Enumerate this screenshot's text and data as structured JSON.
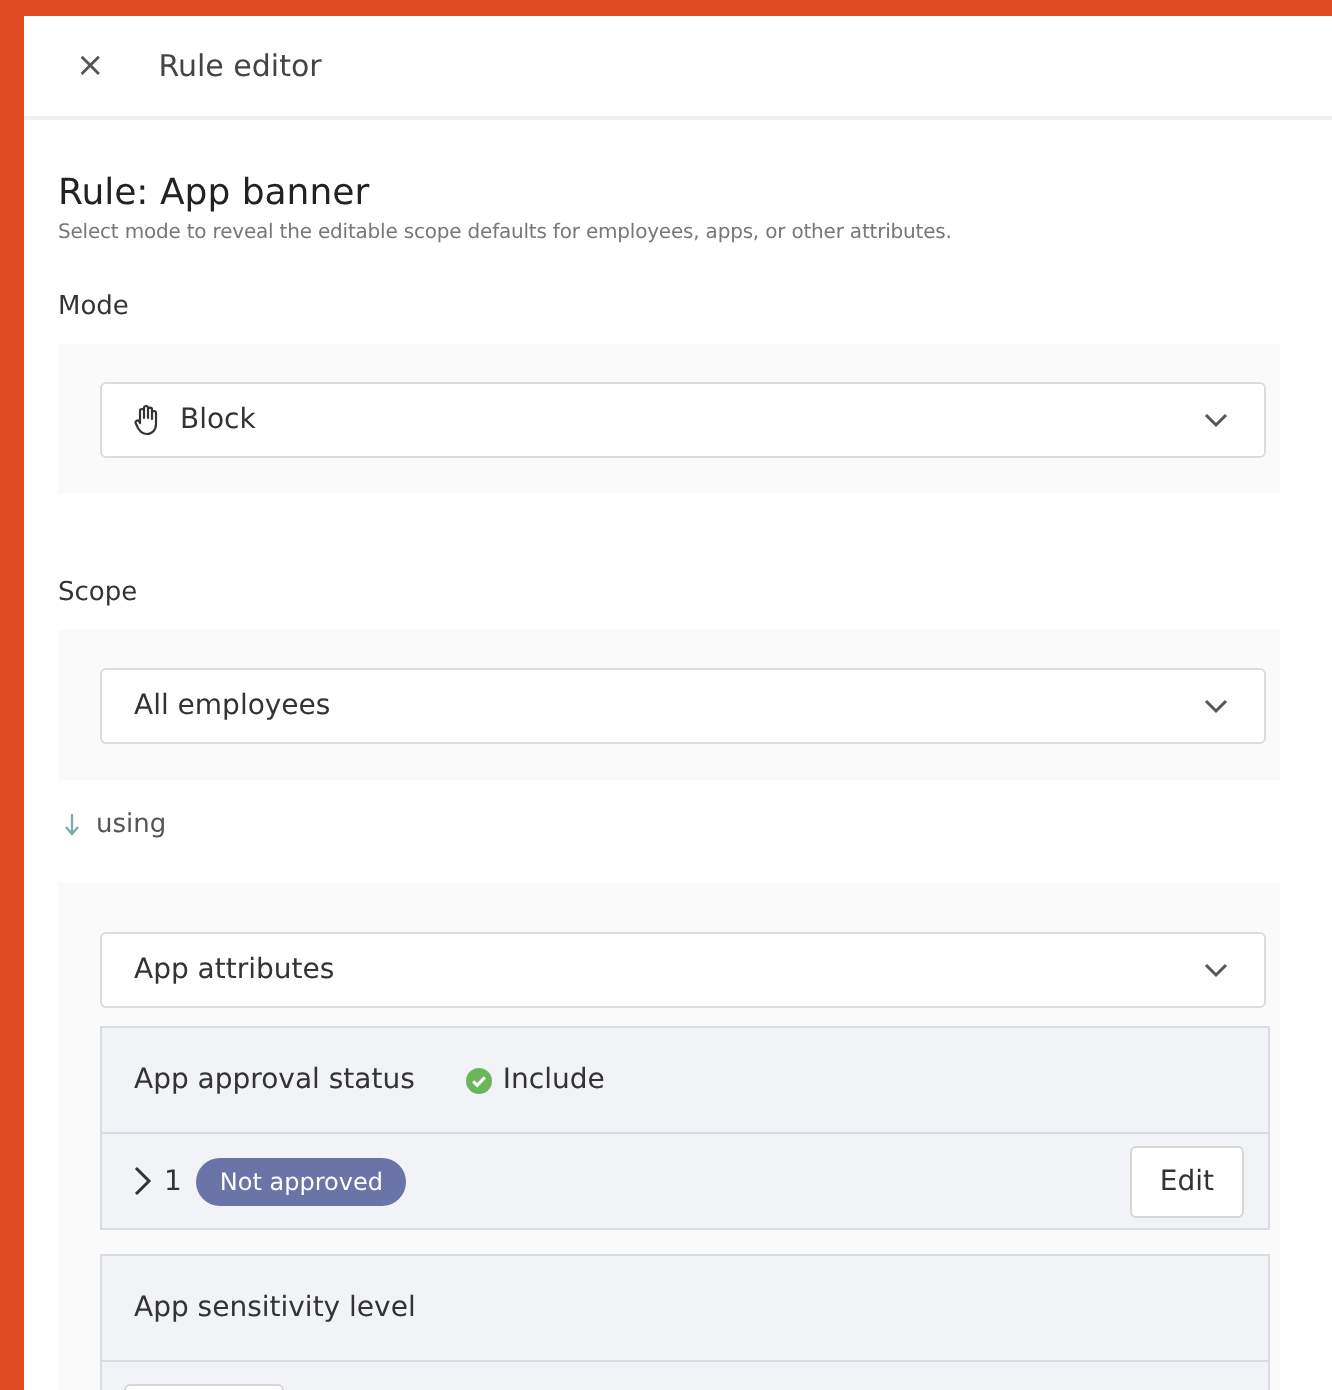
{
  "header": {
    "close": "×",
    "title": "Rule editor"
  },
  "rule": {
    "title": "Rule: App banner",
    "description": "Select mode to reveal the editable scope defaults for employees, apps, or other attributes."
  },
  "mode": {
    "label": "Mode",
    "value": "Block"
  },
  "scope": {
    "label": "Scope",
    "value": "All employees"
  },
  "using": {
    "label": "using",
    "value": "App attributes"
  },
  "attributes": [
    {
      "name": "App approval status",
      "status": "Include",
      "included": true,
      "expanded": false,
      "count": "1",
      "tag": "Not approved",
      "edit": "Edit"
    },
    {
      "name": "App sensitivity level"
    }
  ]
}
